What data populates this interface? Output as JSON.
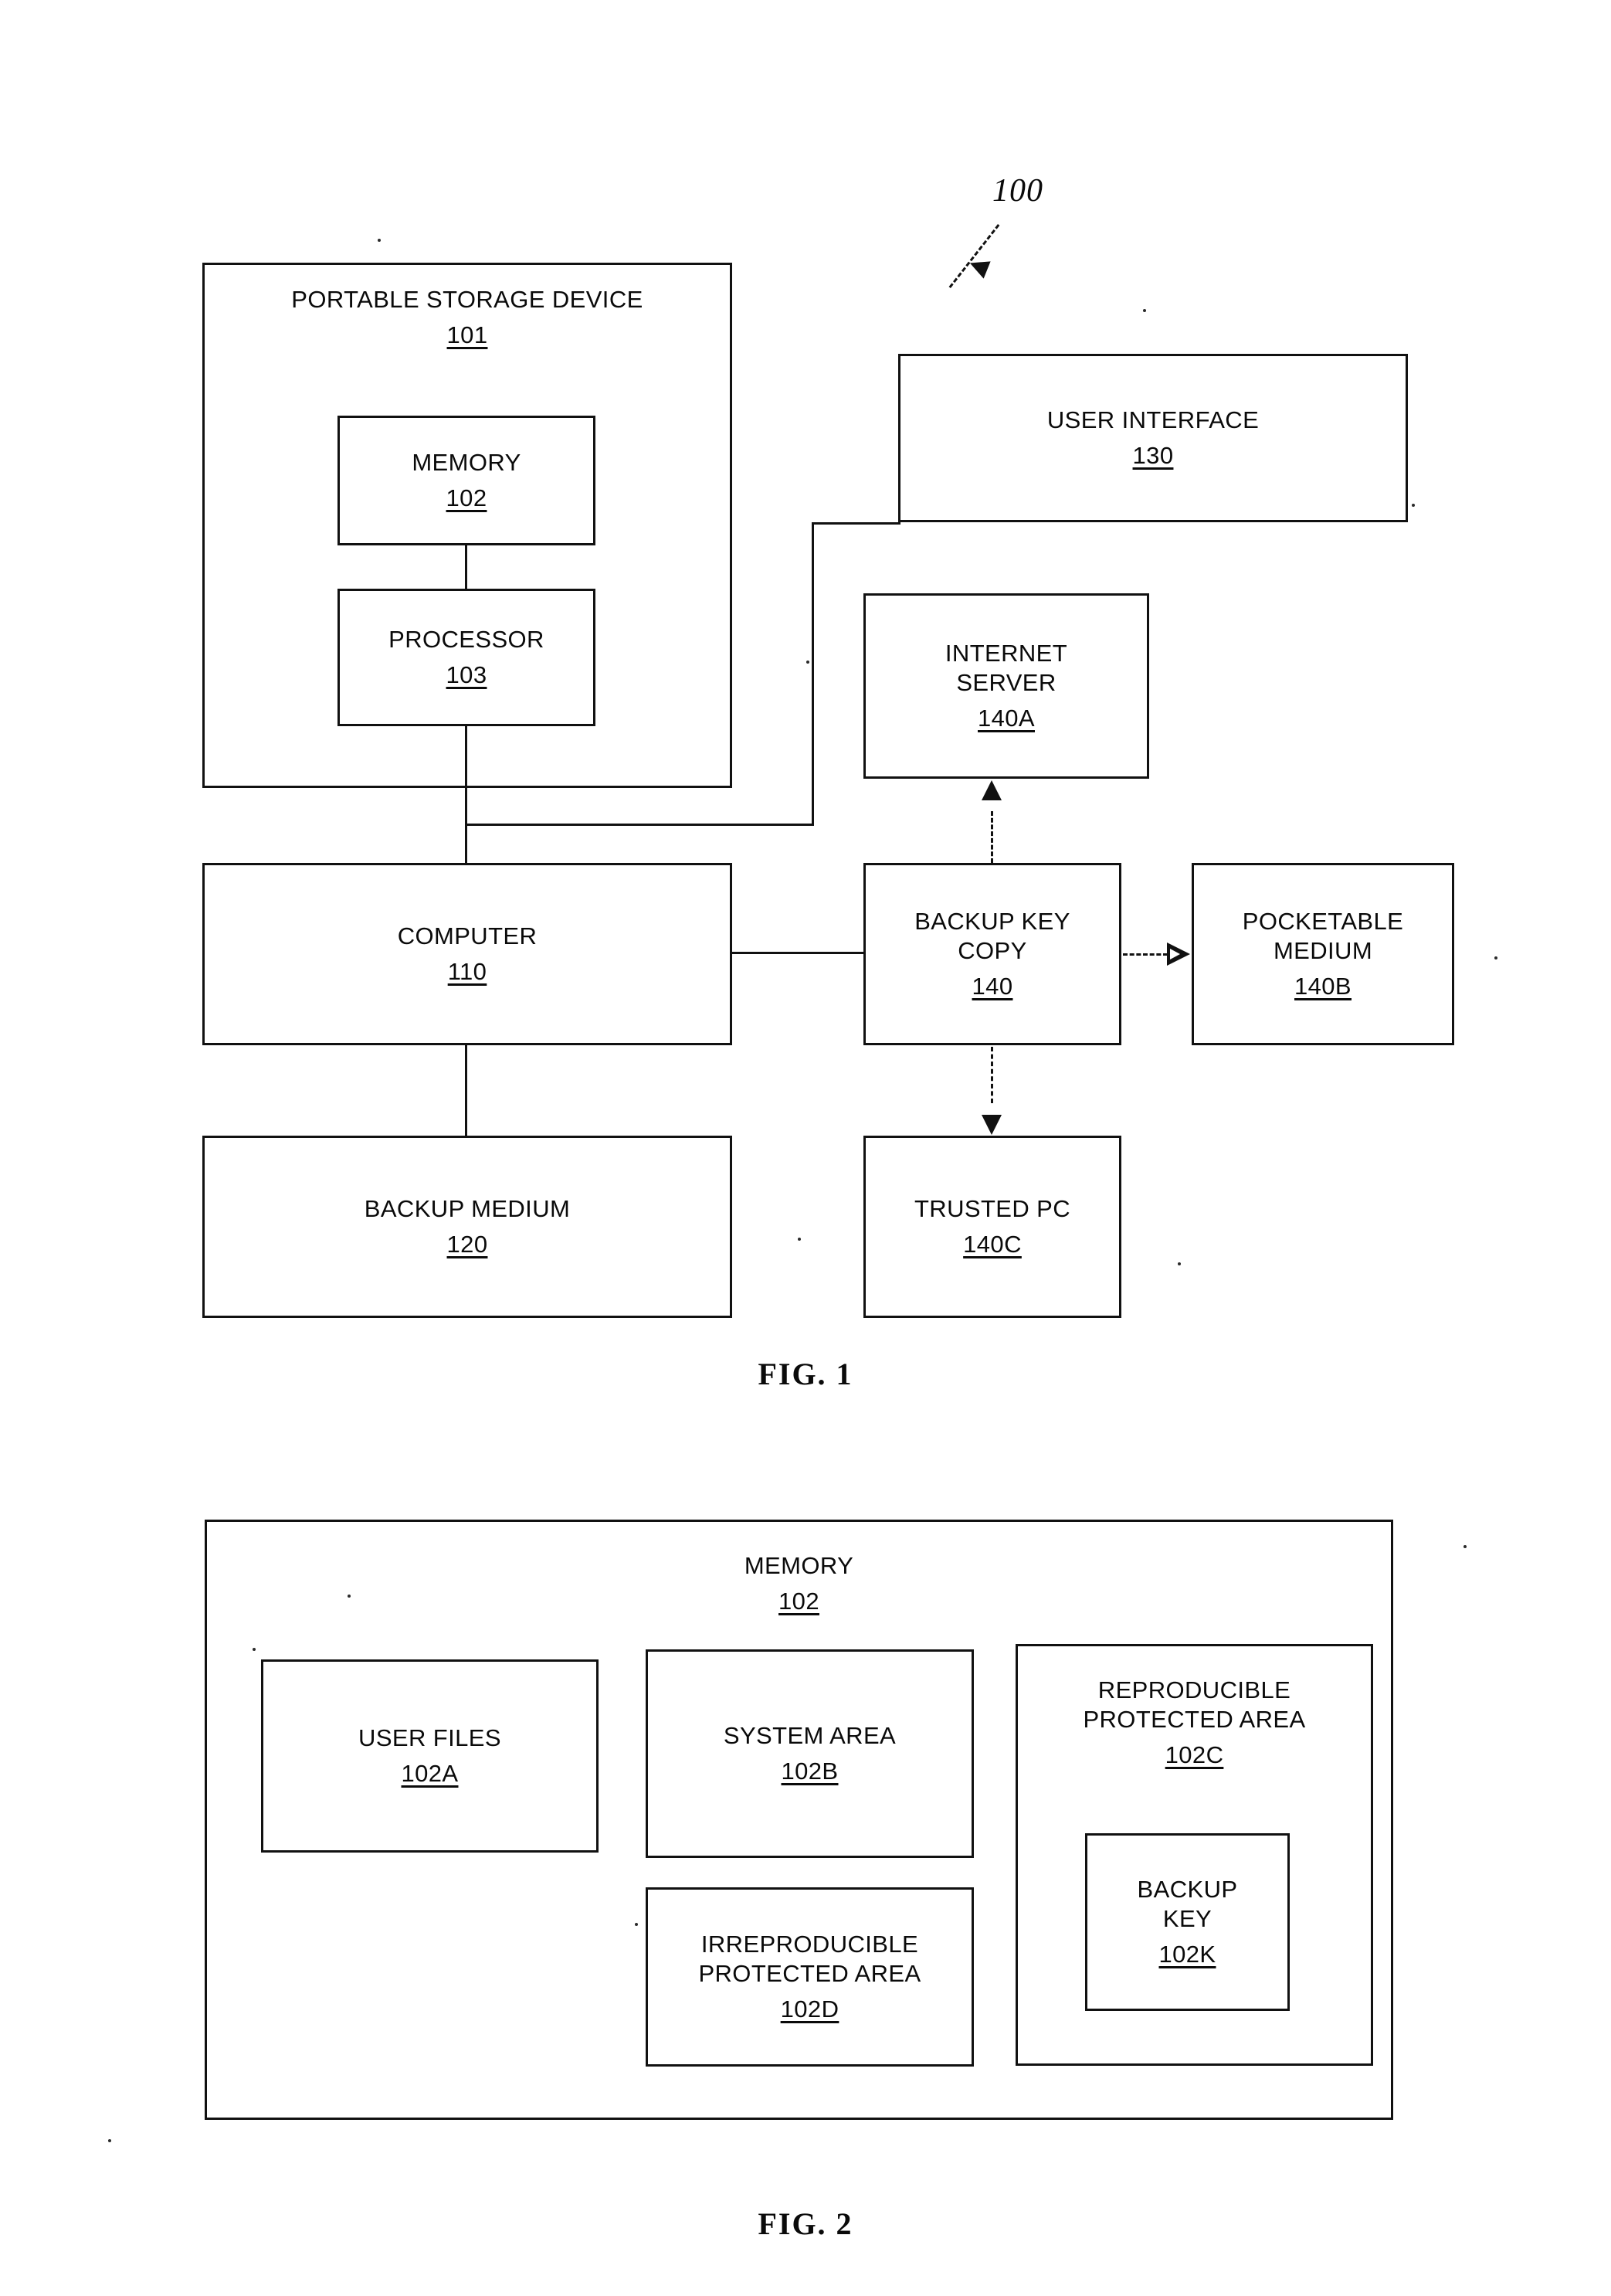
{
  "document": {
    "kind": "patent-drawing-sheet",
    "figures": [
      {
        "caption": "FIG. 1",
        "callout": "100",
        "blocks": [
          {
            "id": "psd",
            "title": "PORTABLE STORAGE DEVICE",
            "ref": "101"
          },
          {
            "id": "memory",
            "title": "MEMORY",
            "ref": "102"
          },
          {
            "id": "processor",
            "title": "PROCESSOR",
            "ref": "103"
          },
          {
            "id": "user_interface",
            "title": "USER INTERFACE",
            "ref": "130"
          },
          {
            "id": "internet_server",
            "title": "INTERNET\nSERVER",
            "ref": "140A"
          },
          {
            "id": "computer",
            "title": "COMPUTER",
            "ref": "110"
          },
          {
            "id": "backup_key_copy",
            "title": "BACKUP KEY\nCOPY",
            "ref": "140"
          },
          {
            "id": "pocketable",
            "title": "POCKETABLE\nMEDIUM",
            "ref": "140B"
          },
          {
            "id": "backup_medium",
            "title": "BACKUP MEDIUM",
            "ref": "120"
          },
          {
            "id": "trusted_pc",
            "title": "TRUSTED PC",
            "ref": "140C"
          }
        ]
      },
      {
        "caption": "FIG. 2",
        "blocks": [
          {
            "id": "memory2",
            "title": "MEMORY",
            "ref": "102"
          },
          {
            "id": "user_files",
            "title": "USER FILES",
            "ref": "102A"
          },
          {
            "id": "system_area",
            "title": "SYSTEM AREA",
            "ref": "102B"
          },
          {
            "id": "repro_area",
            "title": "REPRODUCIBLE\nPROTECTED AREA",
            "ref": "102C"
          },
          {
            "id": "irrepro_area",
            "title": "IRREPRODUCIBLE\nPROTECTED AREA",
            "ref": "102D"
          },
          {
            "id": "backup_key",
            "title": "BACKUP\nKEY",
            "ref": "102K"
          }
        ]
      }
    ]
  },
  "colors": {
    "ink": "#111111",
    "paper": "#ffffff"
  }
}
